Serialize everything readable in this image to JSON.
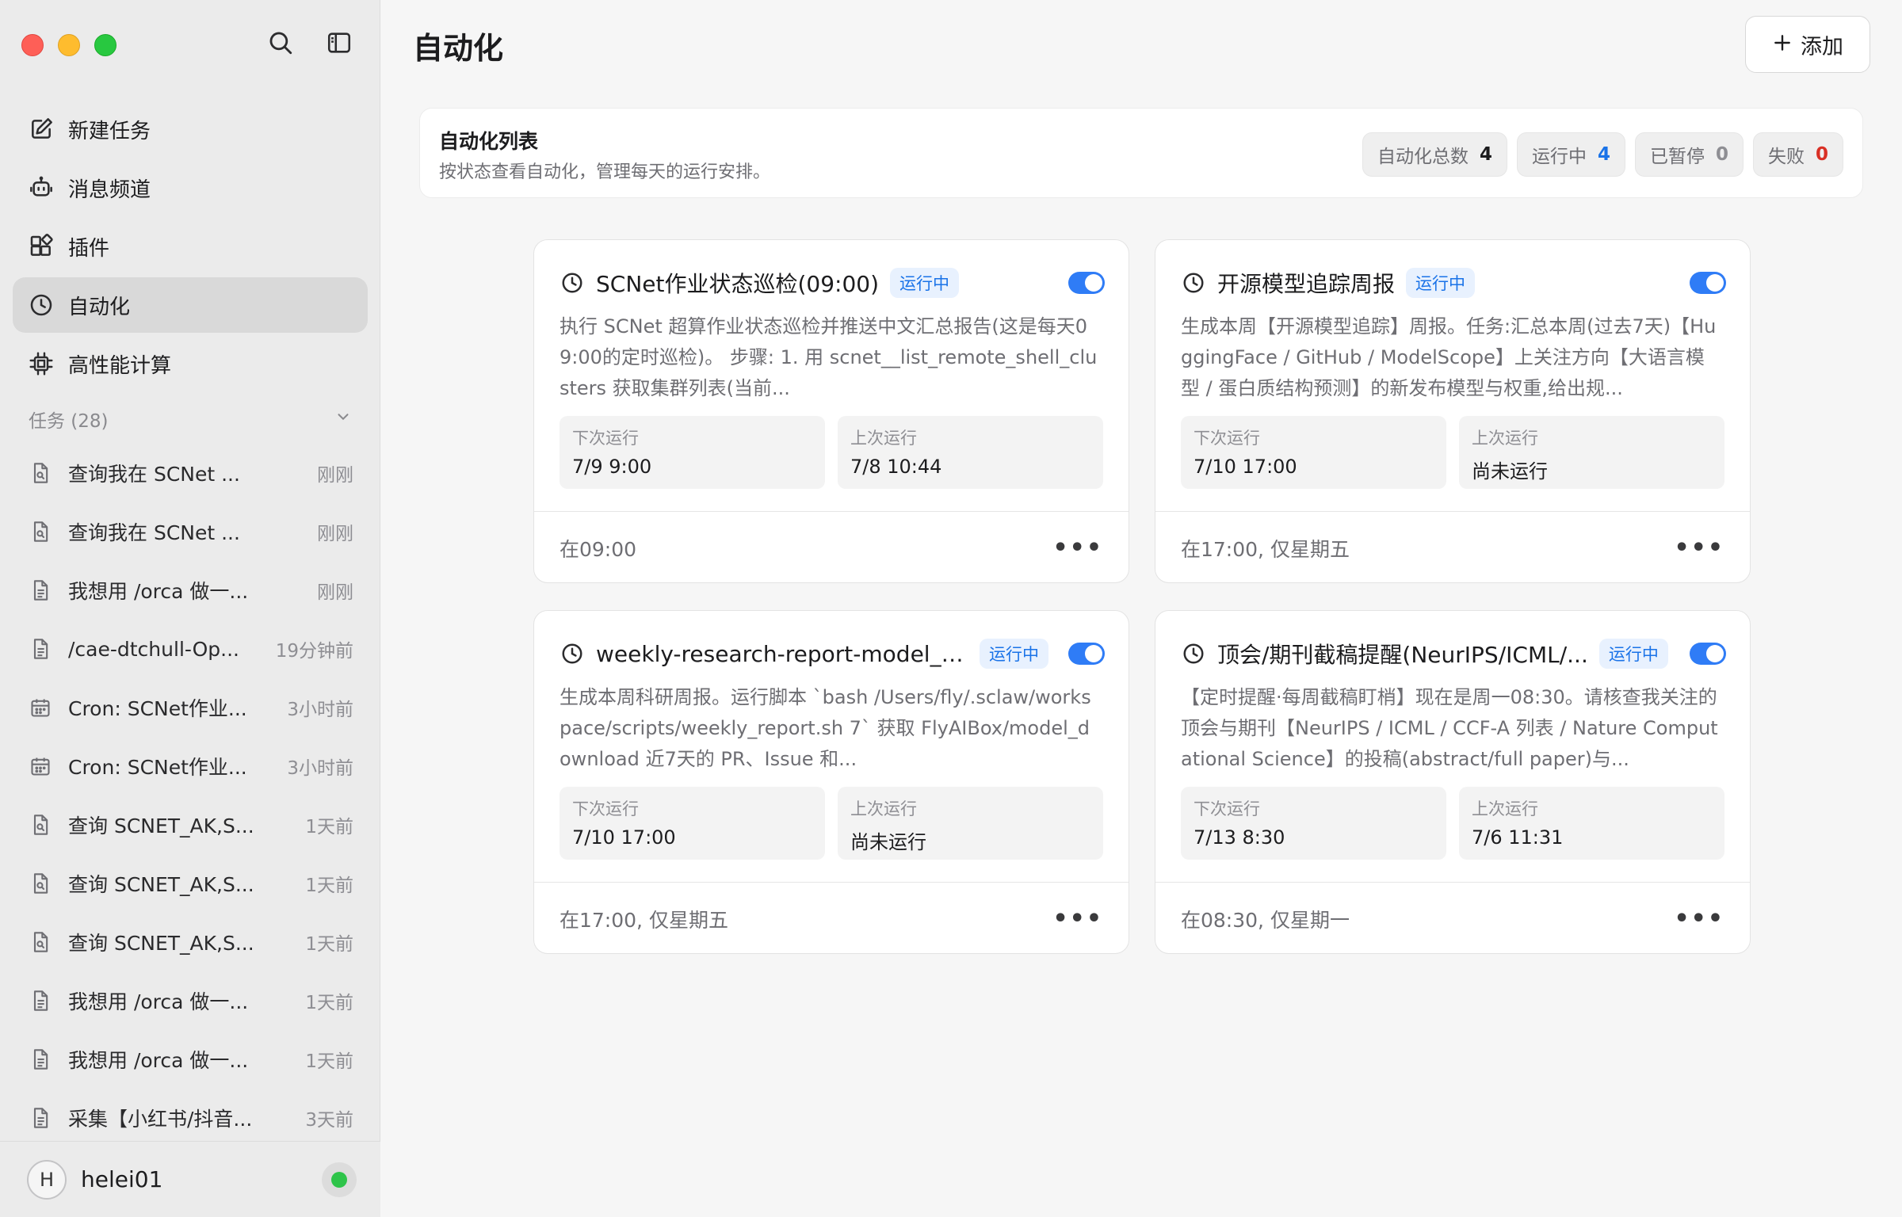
{
  "sidebar": {
    "nav": [
      {
        "label": "新建任务",
        "icon": "edit-icon"
      },
      {
        "label": "消息频道",
        "icon": "bot-icon"
      },
      {
        "label": "插件",
        "icon": "plugin-icon"
      },
      {
        "label": "自动化",
        "icon": "clock-icon",
        "active": true
      },
      {
        "label": "高性能计算",
        "icon": "chip-icon"
      }
    ],
    "tasks_header": "任务 (28)",
    "tasks": [
      {
        "name": "查询我在 SCNet ...",
        "time": "刚刚",
        "icon": "search-doc-icon"
      },
      {
        "name": "查询我在 SCNet ...",
        "time": "刚刚",
        "icon": "search-doc-icon"
      },
      {
        "name": "我想用 /orca 做一...",
        "time": "刚刚",
        "icon": "document-icon"
      },
      {
        "name": "/cae-dtchull-Op...",
        "time": "19分钟前",
        "icon": "document-icon"
      },
      {
        "name": "Cron: SCNet作业...",
        "time": "3小时前",
        "icon": "calendar-icon"
      },
      {
        "name": "Cron: SCNet作业...",
        "time": "3小时前",
        "icon": "calendar-icon"
      },
      {
        "name": "查询 SCNET_AK,S...",
        "time": "1天前",
        "icon": "search-doc-icon"
      },
      {
        "name": "查询 SCNET_AK,S...",
        "time": "1天前",
        "icon": "search-doc-icon"
      },
      {
        "name": "查询 SCNET_AK,S...",
        "time": "1天前",
        "icon": "search-doc-icon"
      },
      {
        "name": "我想用 /orca 做一...",
        "time": "1天前",
        "icon": "document-icon"
      },
      {
        "name": "我想用 /orca 做一...",
        "time": "1天前",
        "icon": "document-icon"
      },
      {
        "name": "采集【小红书/抖音...",
        "time": "3天前",
        "icon": "document-icon"
      }
    ],
    "user": {
      "initial": "H",
      "name": "helei01",
      "status_color": "#2ec44a"
    }
  },
  "main": {
    "title": "自动化",
    "add_label": "添加",
    "summary": {
      "title": "自动化列表",
      "subtitle": "按状态查看自动化，管理每天的运行安排。",
      "stats": [
        {
          "label": "自动化总数",
          "value": "4",
          "color": "#1c1c1e"
        },
        {
          "label": "运行中",
          "value": "4",
          "color": "#1a73e8"
        },
        {
          "label": "已暂停",
          "value": "0",
          "color": "#8e8e93"
        },
        {
          "label": "失败",
          "value": "0",
          "color": "#d93025"
        }
      ]
    },
    "cards": [
      {
        "title": "SCNet作业状态巡检(09:00)",
        "status": "运行中",
        "enabled": true,
        "description": "执行 SCNet 超算作业状态巡检并推送中文汇总报告(这是每天09:00的定时巡检)。 步骤: 1. 用 scnet__list_remote_shell_clusters 获取集群列表(当前...",
        "next_label": "下次运行",
        "next_value": "7/9 9:00",
        "last_label": "上次运行",
        "last_value": "7/8 10:44",
        "schedule": "在09:00"
      },
      {
        "title": "开源模型追踪周报",
        "status": "运行中",
        "enabled": true,
        "description": "生成本周【开源模型追踪】周报。任务:汇总本周(过去7天)【HuggingFace / GitHub / ModelScope】上关注方向【大语言模型 / 蛋白质结构预测】的新发布模型与权重,给出规...",
        "next_label": "下次运行",
        "next_value": "7/10 17:00",
        "last_label": "上次运行",
        "last_value": "尚未运行",
        "schedule": "在17:00, 仅星期五"
      },
      {
        "title": "weekly-research-report-model_d...",
        "status": "运行中",
        "enabled": true,
        "description": "生成本周科研周报。运行脚本 `bash /Users/fly/.sclaw/workspace/scripts/weekly_report.sh 7` 获取 FlyAIBox/model_download 近7天的 PR、Issue 和...",
        "next_label": "下次运行",
        "next_value": "7/10 17:00",
        "last_label": "上次运行",
        "last_value": "尚未运行",
        "schedule": "在17:00, 仅星期五"
      },
      {
        "title": "顶会/期刊截稿提醒(NeurIPS/ICML/...",
        "status": "运行中",
        "enabled": true,
        "description": "【定时提醒·每周截稿盯梢】现在是周一08:30。请核查我关注的顶会与期刊【NeurIPS / ICML / CCF-A 列表 / Nature Computational Science】的投稿(abstract/full paper)与...",
        "next_label": "下次运行",
        "next_value": "7/13 8:30",
        "last_label": "上次运行",
        "last_value": "7/6 11:31",
        "schedule": "在08:30, 仅星期一"
      }
    ]
  }
}
